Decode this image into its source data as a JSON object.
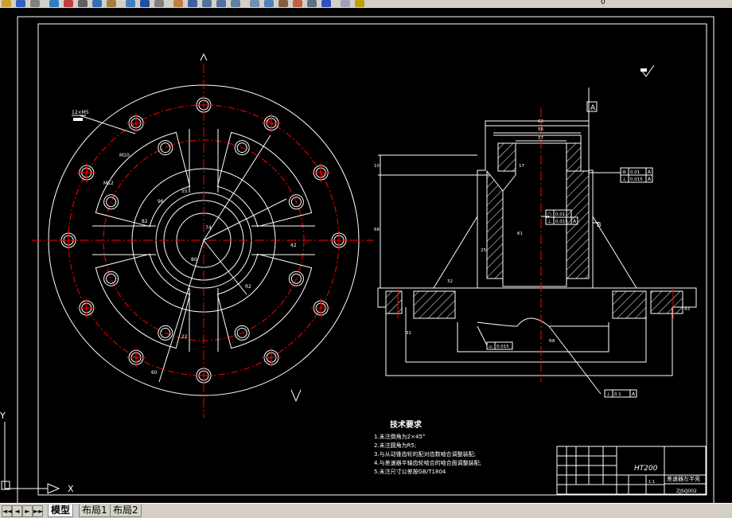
{
  "toolbar": {
    "icons": [
      "open-icon",
      "save-icon",
      "print-icon",
      "preview-icon",
      "publish-icon",
      "cut-icon",
      "copy-icon",
      "paste-icon",
      "matchprop-icon",
      "undo-icon",
      "redo-icon",
      "pan-icon",
      "zoom-realtime-icon",
      "zoom-window-icon",
      "zoom-previous-icon",
      "properties-icon",
      "designcenter-icon",
      "toolpalette-icon",
      "sheetset-icon",
      "markup-icon",
      "calculator-icon",
      "help-icon",
      "layer-icon",
      "layer-state-icon"
    ],
    "layer_value": "0"
  },
  "drawing": {
    "left_view": {
      "hole_label": "12×M5",
      "dim_labels": [
        "M10",
        "M12",
        "96",
        "55",
        "82",
        "74",
        "80",
        "42",
        "R2",
        "22",
        "60"
      ],
      "ucs_label": "Y"
    },
    "section_view": {
      "datum_a": "A",
      "datum_b": "B",
      "dims": [
        "62",
        "56",
        "37",
        "17",
        "68",
        "61",
        "25",
        "32",
        "31",
        "43",
        "R8",
        "10"
      ],
      "tolerances": [
        {
          "sym": "⊚",
          "val": "0.01",
          "ref": "A"
        },
        {
          "sym": "⊥",
          "val": "0.015",
          "ref": "A"
        },
        {
          "sym": "○",
          "val": "0.01"
        },
        {
          "sym": "⊥",
          "val": "0.015",
          "ref": "A"
        },
        {
          "sym": "⌓",
          "val": "0.015"
        },
        {
          "sym": "⊥",
          "val": "0.1",
          "ref": "A"
        }
      ],
      "roughness": "3.2"
    },
    "notes": {
      "title": "技术要求",
      "items": [
        "1.未注倒角为2×45°",
        "2.未注圆角为R5;",
        "3.与从动锥齿轮的配对齿数啮合调整装配;",
        "4.与差速器半轴齿轮啮合的啮合面调整装配;",
        "5.未注尺寸公差按GB/T1804"
      ]
    },
    "title_block": {
      "material": "HT200",
      "part_name": "差速器左半壳",
      "drawing_no": "ZJSQ002",
      "scale_label": "1:1"
    },
    "ucs_icon": {
      "x_label": "X",
      "y_label": "Y"
    }
  },
  "tabs": {
    "items": [
      {
        "label": "模型",
        "active": true
      },
      {
        "label": "布局1",
        "active": false
      },
      {
        "label": "布局2",
        "active": false
      }
    ],
    "nav": [
      "◄◄",
      "◄",
      "►",
      "►►"
    ]
  },
  "colors": {
    "background": "#000000",
    "line": "#ffffff",
    "centerline": "#ff0000",
    "hatch": "#ffffff",
    "chrome": "#d4d0c8"
  }
}
